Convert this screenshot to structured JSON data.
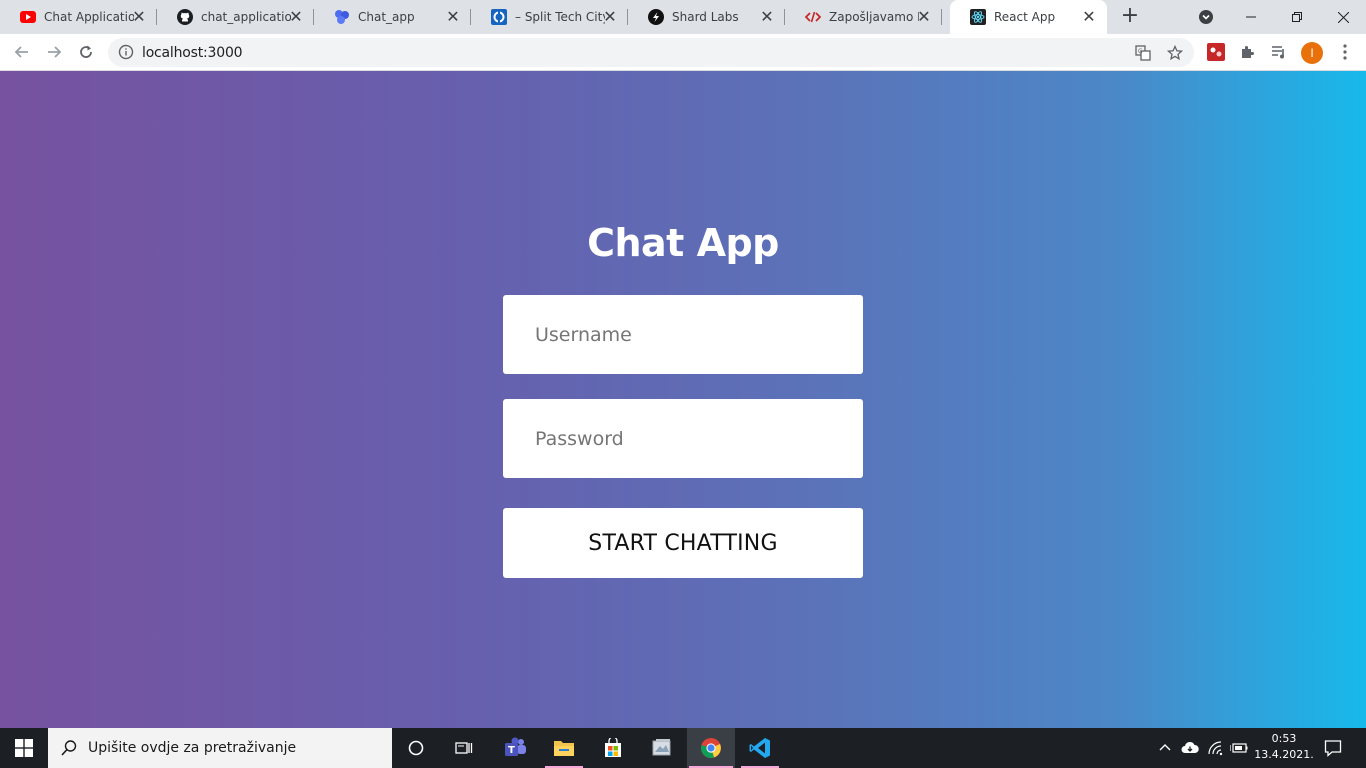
{
  "browser": {
    "tabs": [
      {
        "title": "Chat Application",
        "favicon": "youtube-icon",
        "active": false
      },
      {
        "title": "chat_application/",
        "favicon": "github-icon",
        "active": false
      },
      {
        "title": "Chat_app",
        "favicon": "chat-engine-icon",
        "active": false
      },
      {
        "title": "– Split Tech City",
        "favicon": "split-tech-icon",
        "active": false
      },
      {
        "title": "Shard Labs",
        "favicon": "shard-labs-icon",
        "active": false
      },
      {
        "title": "Zapošljavamo Fro",
        "favicon": "code-icon",
        "active": false
      },
      {
        "title": "React App",
        "favicon": "react-icon",
        "active": true
      }
    ],
    "new_tab": "+",
    "close_glyph": "✕",
    "url": "localhost:3000",
    "profile_initial": "I",
    "accent": "#e8710a"
  },
  "app": {
    "title": "Chat App",
    "username_placeholder": "Username",
    "password_placeholder": "Password",
    "submit_label": "START CHATTING",
    "gradient_start": "#7652a0",
    "gradient_end": "#17b9eb"
  },
  "taskbar": {
    "search_placeholder": "Upišite ovdje za pretraživanje",
    "time": "0:53",
    "date": "13.4.2021."
  }
}
